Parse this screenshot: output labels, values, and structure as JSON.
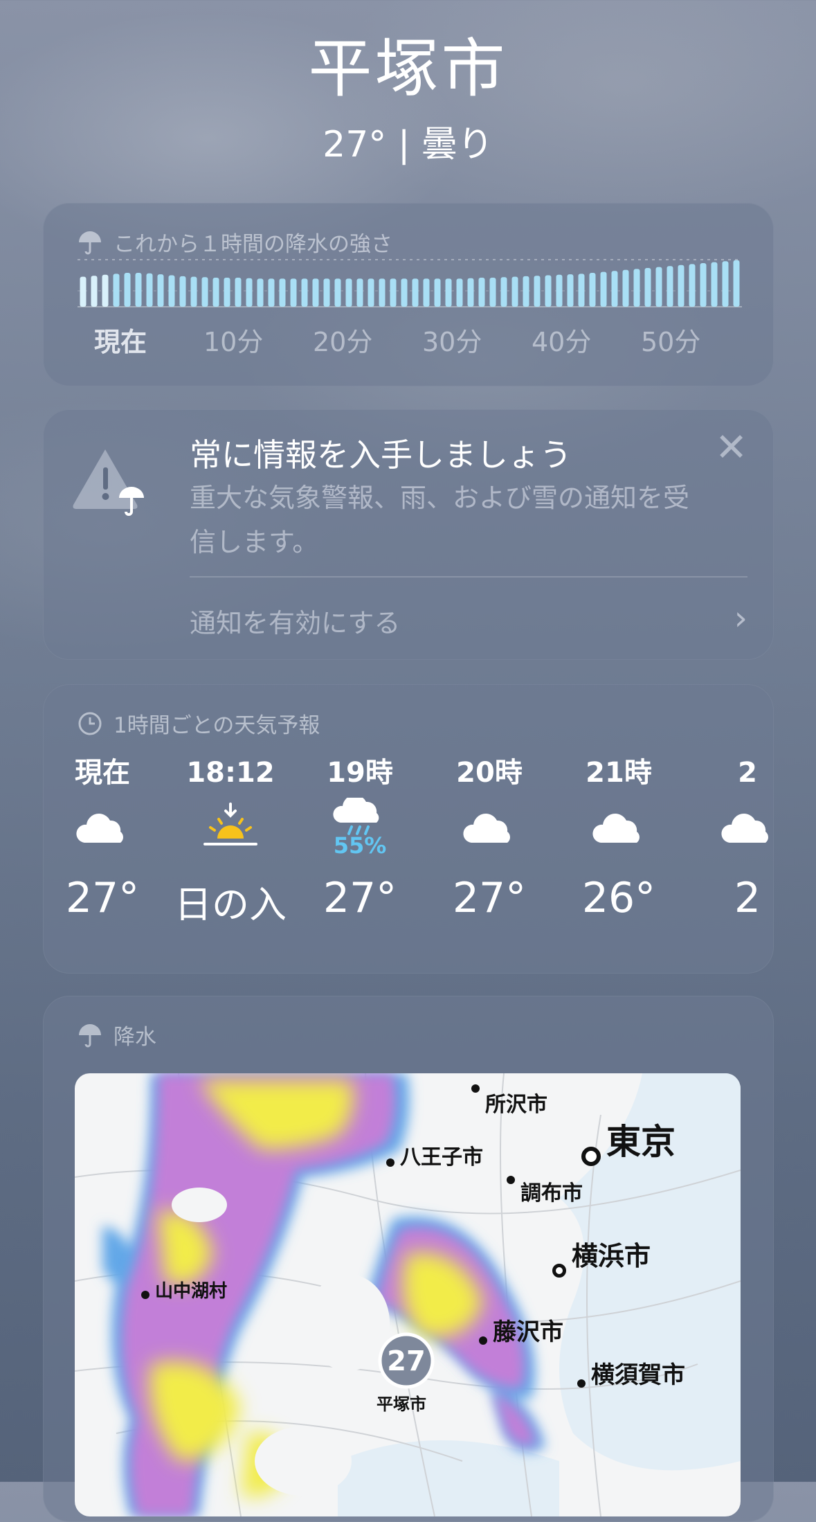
{
  "header": {
    "city": "平塚市",
    "condition": "27° | 曇り"
  },
  "precip_card": {
    "title": "これから１時間の降水の強さ",
    "ticks": [
      "現在",
      "10分",
      "20分",
      "30分",
      "40分",
      "50分"
    ],
    "intensity": [
      0.62,
      0.64,
      0.66,
      0.68,
      0.7,
      0.7,
      0.69,
      0.67,
      0.65,
      0.63,
      0.62,
      0.61,
      0.6,
      0.6,
      0.6,
      0.59,
      0.58,
      0.58,
      0.58,
      0.58,
      0.58,
      0.58,
      0.58,
      0.58,
      0.58,
      0.58,
      0.58,
      0.58,
      0.58,
      0.58,
      0.58,
      0.58,
      0.58,
      0.58,
      0.58,
      0.59,
      0.6,
      0.6,
      0.61,
      0.62,
      0.63,
      0.64,
      0.65,
      0.66,
      0.67,
      0.68,
      0.7,
      0.72,
      0.74,
      0.76,
      0.78,
      0.8,
      0.82,
      0.84,
      0.86,
      0.88,
      0.9,
      0.92,
      0.94,
      0.96
    ]
  },
  "notify_card": {
    "title": "常に情報を入手しましょう",
    "body": "重大な気象警報、雨、および雪の通知を受信します。",
    "link": "通知を有効にする",
    "close": "✕",
    "chevron": "›"
  },
  "hourly_card": {
    "title": "1時間ごとの天気予報",
    "hours": [
      {
        "time": "現在",
        "icon": "cloud-icon",
        "pct": "",
        "temp": "27°"
      },
      {
        "time": "18:12",
        "icon": "sunset-icon",
        "pct": "",
        "temp": "日の入"
      },
      {
        "time": "19時",
        "icon": "rain-cloud-icon",
        "pct": "55%",
        "temp": "27°"
      },
      {
        "time": "20時",
        "icon": "cloud-icon",
        "pct": "",
        "temp": "27°"
      },
      {
        "time": "21時",
        "icon": "cloud-icon",
        "pct": "",
        "temp": "26°"
      },
      {
        "time": "2",
        "icon": "cloud-icon",
        "pct": "",
        "temp": "2"
      }
    ]
  },
  "map_card": {
    "title": "降水",
    "places": {
      "tokorozawa": "所沢市",
      "tokyo": "東京",
      "hachioji": "八王子市",
      "chofu": "調布市",
      "yokohama": "横浜市",
      "yamanakako": "山中湖村",
      "fujisawa": "藤沢市",
      "yokosuka": "横須賀市",
      "hiratsuka": "平塚市"
    },
    "badge_temp": "27"
  },
  "colors": {
    "rain_blue": "#62c6f2",
    "sun_yellow": "#f7c21c",
    "radar_purple": "#c27fd8",
    "radar_yellow": "#f2ec4a"
  }
}
